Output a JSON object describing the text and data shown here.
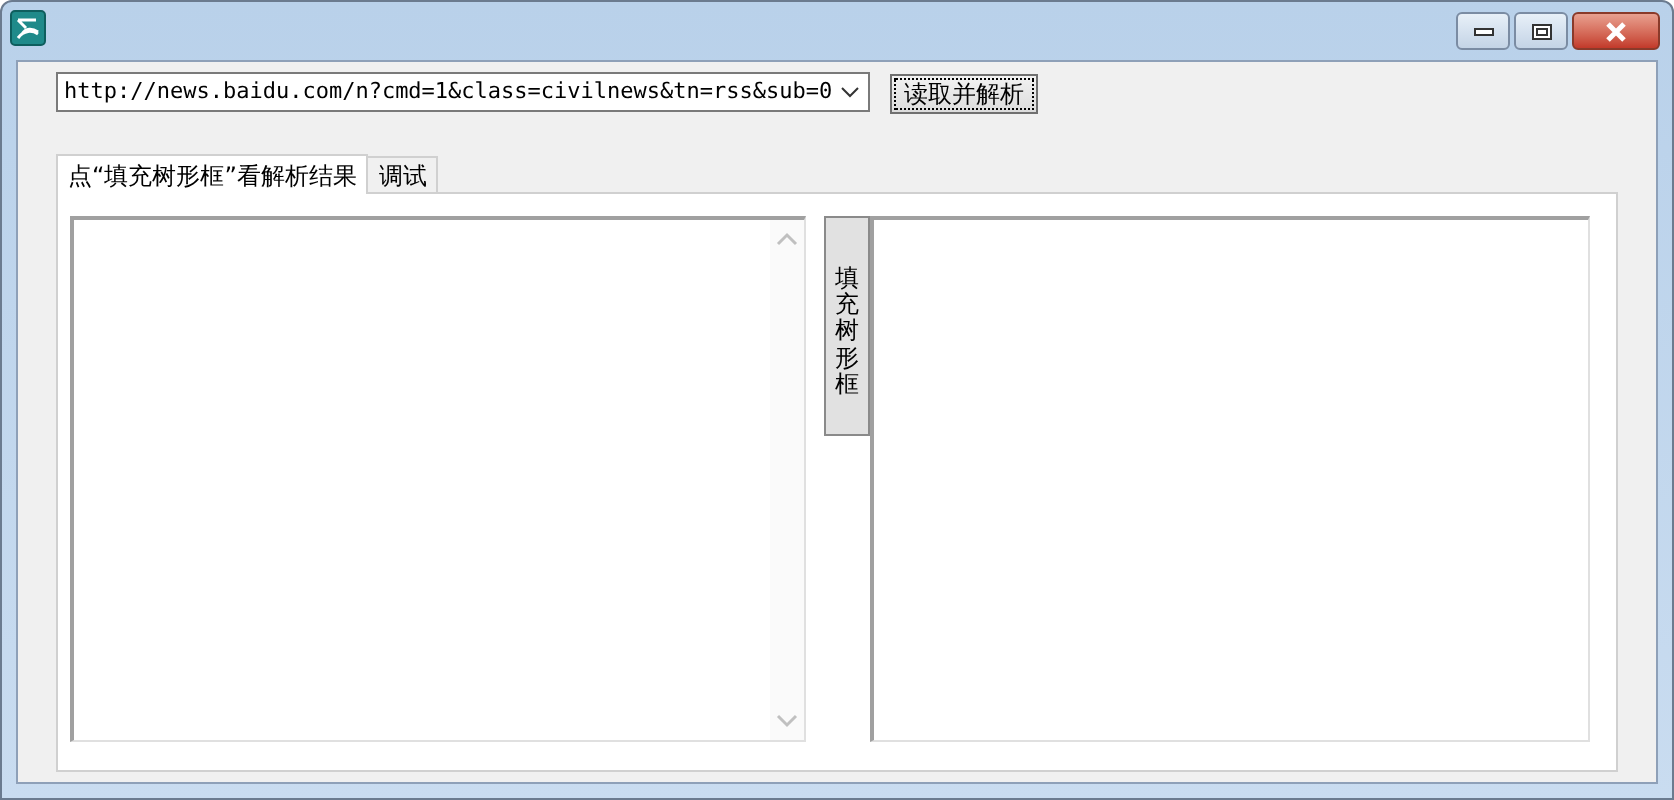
{
  "url_field": {
    "value": "http://news.baidu.com/n?cmd=1&class=civilnews&tn=rss&sub=0"
  },
  "fetch_button": {
    "label": "读取并解析"
  },
  "tabs": [
    {
      "label": "点“填充树形框”看解析结果",
      "selected": true
    },
    {
      "label": "调试",
      "selected": false
    }
  ],
  "fill_tree_button": {
    "label": "填充树形框"
  }
}
